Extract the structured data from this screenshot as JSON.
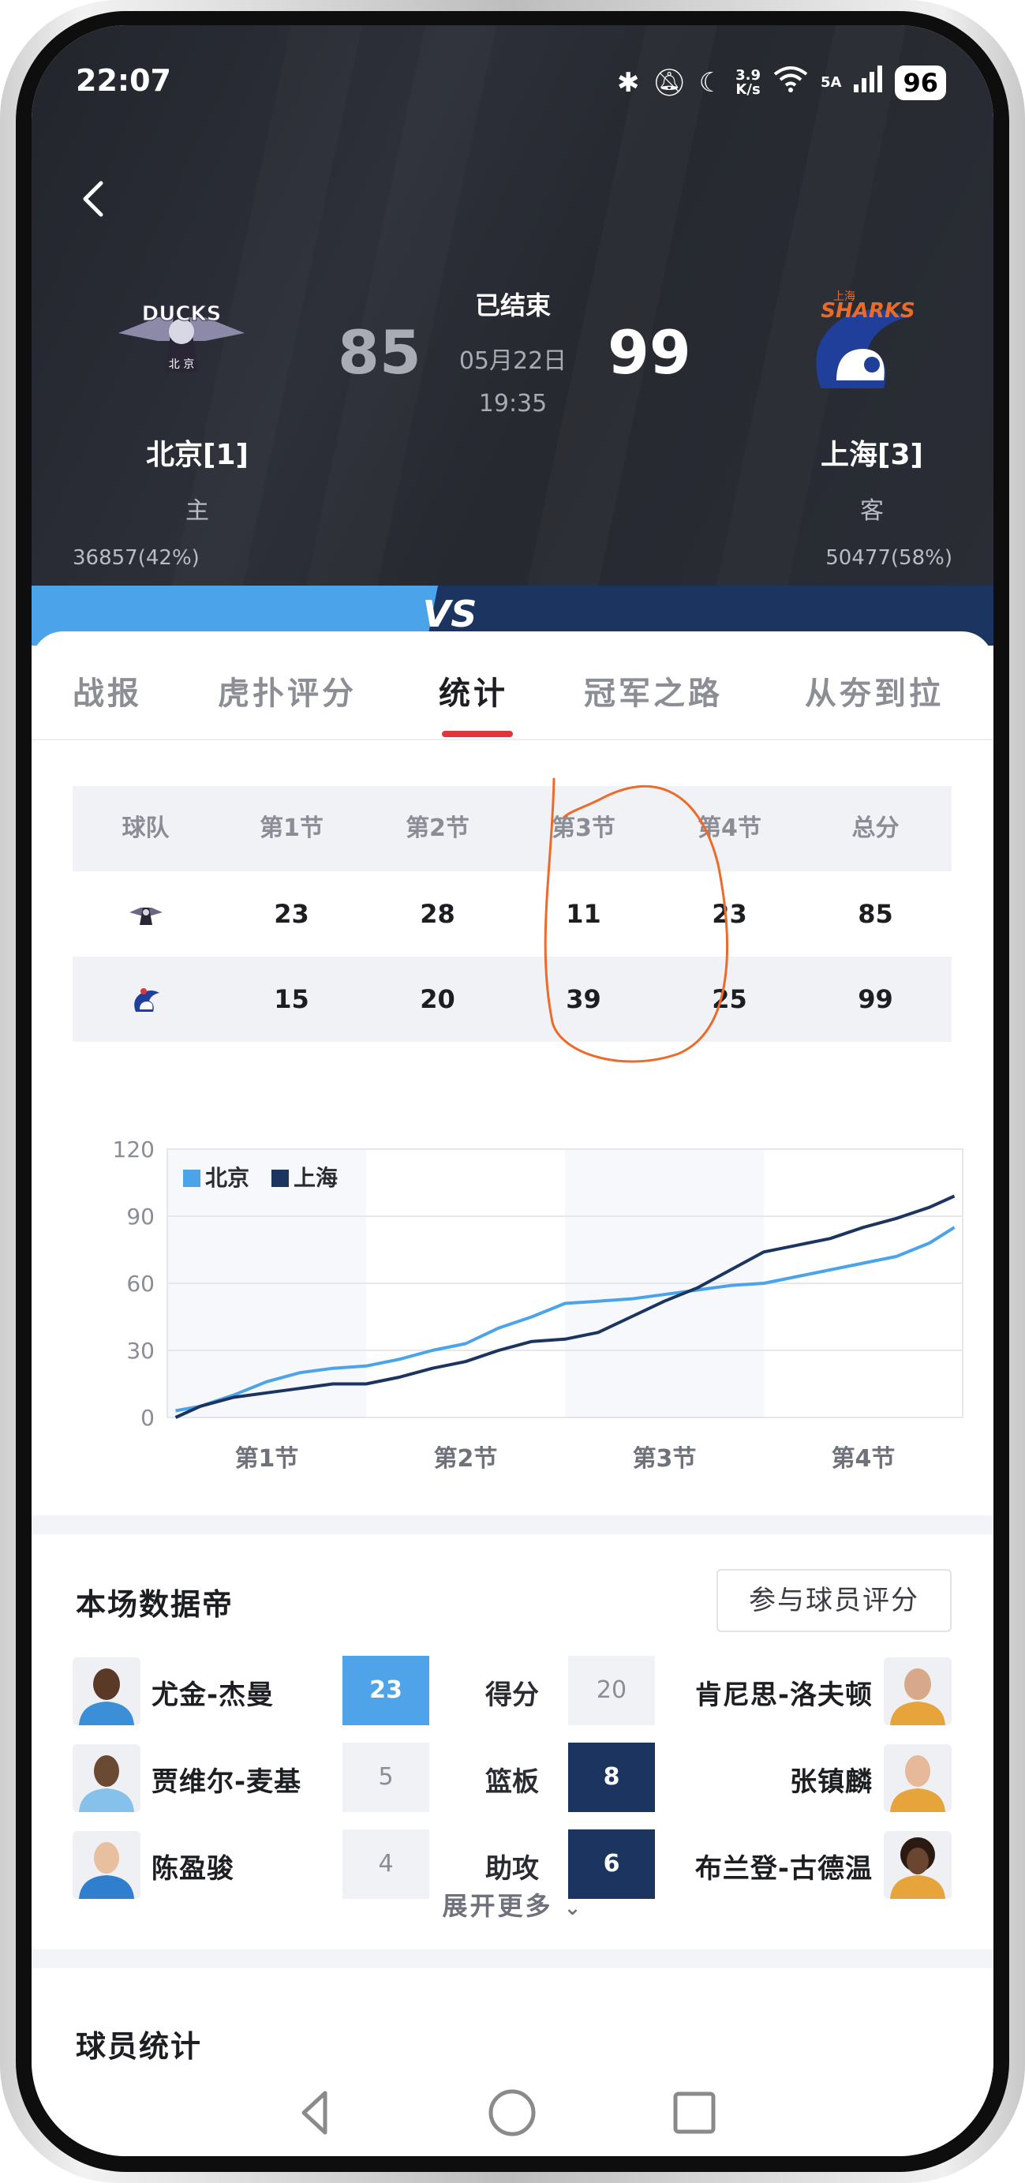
{
  "status_bar": {
    "time": "22:07",
    "net_speed_top": "3.9",
    "net_speed_bottom": "K/s",
    "network": "5A",
    "battery": "96"
  },
  "game": {
    "status": "已结束",
    "date": "05月22日",
    "time": "19:35",
    "home": {
      "name": "北京[1]",
      "role": "主",
      "score": "85",
      "votes": "36857(42%)",
      "logo_text": "DUCKS",
      "logo_sub": "北 京"
    },
    "away": {
      "name": "上海[3]",
      "role": "客",
      "score": "99",
      "votes": "50477(58%)",
      "logo_text": "SHARKS",
      "logo_sub": "上海"
    },
    "vs_label": "VS"
  },
  "tabs": [
    {
      "label": "战报"
    },
    {
      "label": "虎扑评分"
    },
    {
      "label": "统计"
    },
    {
      "label": "冠军之路"
    },
    {
      "label": "从夯到拉"
    }
  ],
  "quarter_table": {
    "headers": [
      "球队",
      "第1节",
      "第2节",
      "第3节",
      "第4节",
      "总分"
    ],
    "rows": [
      {
        "team": "北京",
        "values": [
          "23",
          "28",
          "11",
          "23",
          "85"
        ]
      },
      {
        "team": "上海",
        "values": [
          "15",
          "20",
          "39",
          "25",
          "99"
        ]
      }
    ]
  },
  "chart_data": {
    "type": "line",
    "title": "",
    "xlabel": "",
    "ylabel": "",
    "x_categories": [
      "第1节",
      "第2节",
      "第3节",
      "第4节"
    ],
    "y_ticks": [
      "0",
      "30",
      "60",
      "90",
      "120"
    ],
    "ylim": [
      0,
      120
    ],
    "xlim": [
      0,
      48
    ],
    "legend": "top-left",
    "series": [
      {
        "name": "北京",
        "color": "#4ba3ea",
        "points": [
          [
            0.5,
            3
          ],
          [
            2,
            5
          ],
          [
            4,
            10
          ],
          [
            6,
            16
          ],
          [
            8,
            20
          ],
          [
            10,
            22
          ],
          [
            12,
            23
          ],
          [
            14,
            26
          ],
          [
            16,
            30
          ],
          [
            18,
            33
          ],
          [
            20,
            40
          ],
          [
            22,
            45
          ],
          [
            24,
            51
          ],
          [
            26,
            52
          ],
          [
            28,
            53
          ],
          [
            30,
            55
          ],
          [
            32,
            57
          ],
          [
            34,
            59
          ],
          [
            36,
            60
          ],
          [
            38,
            63
          ],
          [
            40,
            66
          ],
          [
            42,
            69
          ],
          [
            44,
            72
          ],
          [
            46,
            78
          ],
          [
            47.5,
            85
          ]
        ]
      },
      {
        "name": "上海",
        "color": "#1c3560",
        "points": [
          [
            0.5,
            0
          ],
          [
            2,
            5
          ],
          [
            4,
            9
          ],
          [
            6,
            11
          ],
          [
            8,
            13
          ],
          [
            10,
            15
          ],
          [
            12,
            15
          ],
          [
            14,
            18
          ],
          [
            16,
            22
          ],
          [
            18,
            25
          ],
          [
            20,
            30
          ],
          [
            22,
            34
          ],
          [
            24,
            35
          ],
          [
            26,
            38
          ],
          [
            28,
            45
          ],
          [
            30,
            52
          ],
          [
            32,
            58
          ],
          [
            34,
            66
          ],
          [
            36,
            74
          ],
          [
            38,
            77
          ],
          [
            40,
            80
          ],
          [
            42,
            85
          ],
          [
            44,
            89
          ],
          [
            46,
            94
          ],
          [
            47.5,
            99
          ]
        ]
      }
    ]
  },
  "data_board": {
    "title": "本场数据帝",
    "rate_button": "参与球员评分",
    "rows": [
      {
        "stat": "得分",
        "left_name": "尤金-杰曼",
        "left_value": "23",
        "right_value": "20",
        "right_name": "肯尼思-洛夫顿",
        "leader": "left"
      },
      {
        "stat": "篮板",
        "left_name": "贾维尔-麦基",
        "left_value": "5",
        "right_value": "8",
        "right_name": "张镇麟",
        "leader": "right"
      },
      {
        "stat": "助攻",
        "left_name": "陈盈骏",
        "left_value": "4",
        "right_value": "6",
        "right_name": "布兰登-古德温",
        "leader": "right"
      }
    ],
    "more_label": "展开更多"
  },
  "player_stats_title": "球员统计",
  "colors": {
    "beijing": "#4ba3ea",
    "shanghai": "#1c3560",
    "accent_red": "#e0353a",
    "annotation_orange": "#ec6a2a"
  }
}
